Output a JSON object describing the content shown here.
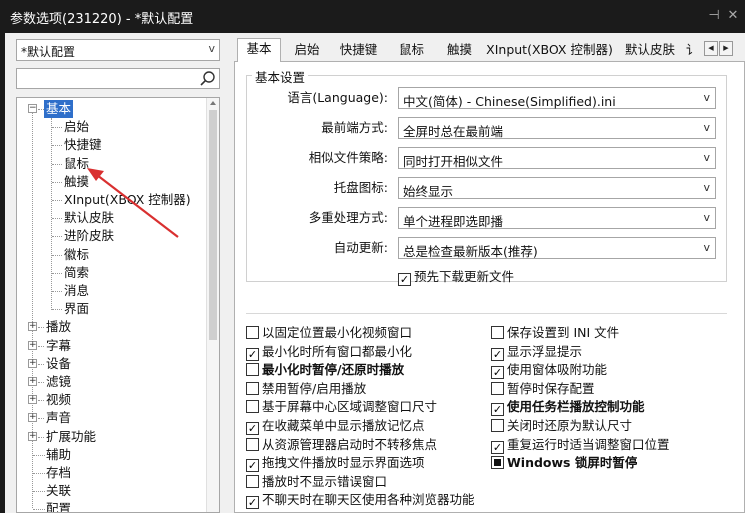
{
  "window": {
    "title": "参数选项(231220) - *默认配置",
    "pin_glyph": "⊣",
    "close_glyph": "✕"
  },
  "left": {
    "profile_value": "*默认配置",
    "dropdown_glyph": "v",
    "search_placeholder": "",
    "tree": [
      {
        "label": "基本",
        "selected": true
      },
      {
        "label": "启始"
      },
      {
        "label": "快捷键"
      },
      {
        "label": "鼠标"
      },
      {
        "label": "触摸"
      },
      {
        "label": "XInput(XBOX 控制器)"
      },
      {
        "label": "默认皮肤"
      },
      {
        "label": "进阶皮肤"
      },
      {
        "label": "徽标"
      },
      {
        "label": "简索"
      },
      {
        "label": "消息"
      },
      {
        "label": "界面"
      },
      {
        "label": "播放"
      },
      {
        "label": "字幕"
      },
      {
        "label": "设备"
      },
      {
        "label": "滤镜"
      },
      {
        "label": "视频"
      },
      {
        "label": "声音"
      },
      {
        "label": "扩展功能"
      },
      {
        "label": "辅助"
      },
      {
        "label": "存档"
      },
      {
        "label": "关联"
      },
      {
        "label": "配置"
      }
    ]
  },
  "tabs": {
    "items": [
      "基本",
      "启始",
      "快捷键",
      "鼠标",
      "触摸",
      "XInput(XBOX 控制器)",
      "默认皮肤",
      "讠"
    ],
    "scroll_left": "◀",
    "scroll_right": "▶"
  },
  "basic": {
    "group_title": "基本设置",
    "rows": [
      {
        "label": "语言(Language):",
        "value": "中文(简体) - Chinese(Simplified).ini"
      },
      {
        "label": "最前端方式:",
        "value": "全屏时总在最前端"
      },
      {
        "label": "相似文件策略:",
        "value": "同时打开相似文件"
      },
      {
        "label": "托盘图标:",
        "value": "始终显示"
      },
      {
        "label": "多重处理方式:",
        "value": "单个进程即选即播"
      },
      {
        "label": "自动更新:",
        "value": "总是检查最新版本(推荐)"
      }
    ],
    "dd_arrow": "v",
    "predownload": {
      "label": "预先下载更新文件",
      "checked": true
    }
  },
  "options_left": [
    {
      "label": "以固定位置最小化视频窗口",
      "state": "unchecked",
      "bold": false
    },
    {
      "label": "最小化时所有窗口都最小化",
      "state": "checked",
      "bold": false
    },
    {
      "label": "最小化时暂停/还原时播放",
      "state": "unchecked",
      "bold": true
    },
    {
      "label": "禁用暂停/启用播放",
      "state": "unchecked",
      "bold": false
    },
    {
      "label": "基于屏幕中心区域调整窗口尺寸",
      "state": "unchecked",
      "bold": false
    },
    {
      "label": "在收藏菜单中显示播放记忆点",
      "state": "checked",
      "bold": false
    },
    {
      "label": "从资源管理器启动时不转移焦点",
      "state": "unchecked",
      "bold": false
    },
    {
      "label": "拖拽文件播放时显示界面选项",
      "state": "checked",
      "bold": false
    },
    {
      "label": "播放时不显示错误窗口",
      "state": "unchecked",
      "bold": false
    },
    {
      "label": "不聊天时在聊天区使用各种浏览器功能",
      "state": "checked",
      "bold": false
    }
  ],
  "options_right": [
    {
      "label": "保存设置到 INI 文件",
      "state": "unchecked",
      "bold": false
    },
    {
      "label": "显示浮显提示",
      "state": "checked",
      "bold": false
    },
    {
      "label": "使用窗体吸附功能",
      "state": "checked",
      "bold": false
    },
    {
      "label": "暂停时保存配置",
      "state": "unchecked",
      "bold": false
    },
    {
      "label": "使用任务栏播放控制功能",
      "state": "checked",
      "bold": true
    },
    {
      "label": "关闭时还原为默认尺寸",
      "state": "unchecked",
      "bold": false
    },
    {
      "label": "重复运行时适当调整窗口位置",
      "state": "checked",
      "bold": false
    },
    {
      "label": "Windows 锁屏时暂停",
      "state": "indeterminate",
      "bold": true
    }
  ],
  "colors": {
    "selection": "#2f6fca",
    "annotation_arrow": "#d93030",
    "titlebar": "#1b1b1b"
  }
}
